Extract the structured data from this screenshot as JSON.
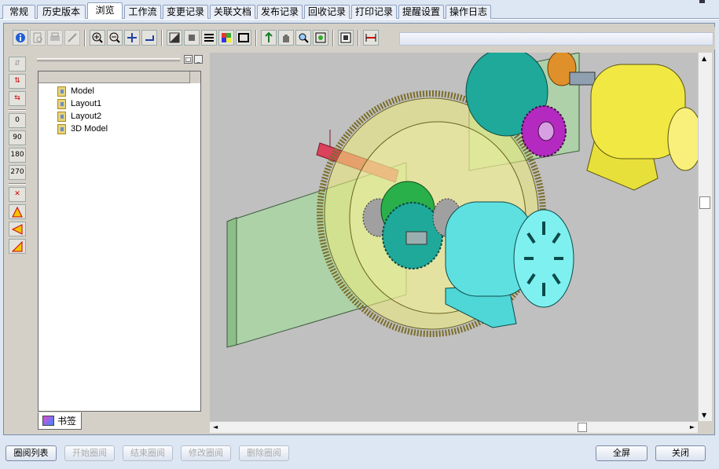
{
  "tabs": [
    {
      "label": "常规"
    },
    {
      "label": "历史版本"
    },
    {
      "label": "浏览"
    },
    {
      "label": "工作流"
    },
    {
      "label": "变更记录"
    },
    {
      "label": "关联文档"
    },
    {
      "label": "发布记录"
    },
    {
      "label": "回收记录"
    },
    {
      "label": "打印记录"
    },
    {
      "label": "提醒设置"
    },
    {
      "label": "操作日志"
    }
  ],
  "active_tab": "浏览",
  "left_toolbar": {
    "rotate_0": "0",
    "rotate_90": "90",
    "rotate_180": "180",
    "rotate_270": "270"
  },
  "tree": {
    "items": [
      {
        "label": "Model"
      },
      {
        "label": "Layout1"
      },
      {
        "label": "Layout2"
      },
      {
        "label": "3D Model"
      }
    ],
    "bookmark_tab": "书签"
  },
  "buttons": {
    "review_list": "圈阅列表",
    "start_review": "开始圈阅",
    "end_review": "结束圈阅",
    "edit_review": "修改圈阅",
    "delete_review": "删除圈阅",
    "fullscreen": "全屏",
    "close": "关闭"
  },
  "colors": {
    "tab_border": "#8ea2c0",
    "background": "#dde6f3",
    "viewport": "#c0c0c0"
  }
}
